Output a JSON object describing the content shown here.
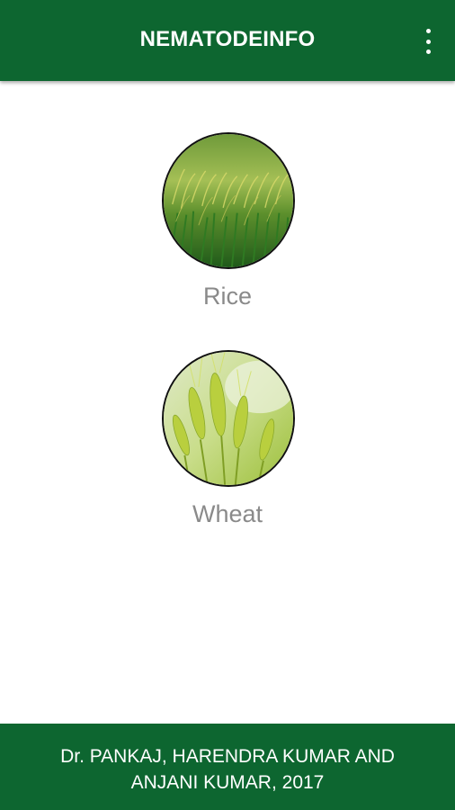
{
  "app_bar": {
    "title": "NEMATODEINFO",
    "menu_icon": "more-vert-icon",
    "background_color": "#0d6630"
  },
  "crops": [
    {
      "label": "Rice",
      "image": "rice-field-image"
    },
    {
      "label": "Wheat",
      "image": "wheat-ears-image"
    }
  ],
  "footer": {
    "credits_line1": "Dr. PANKAJ, HARENDRA KUMAR AND",
    "credits_line2": "ANJANI KUMAR, 2017",
    "background_color": "#0d6630"
  }
}
